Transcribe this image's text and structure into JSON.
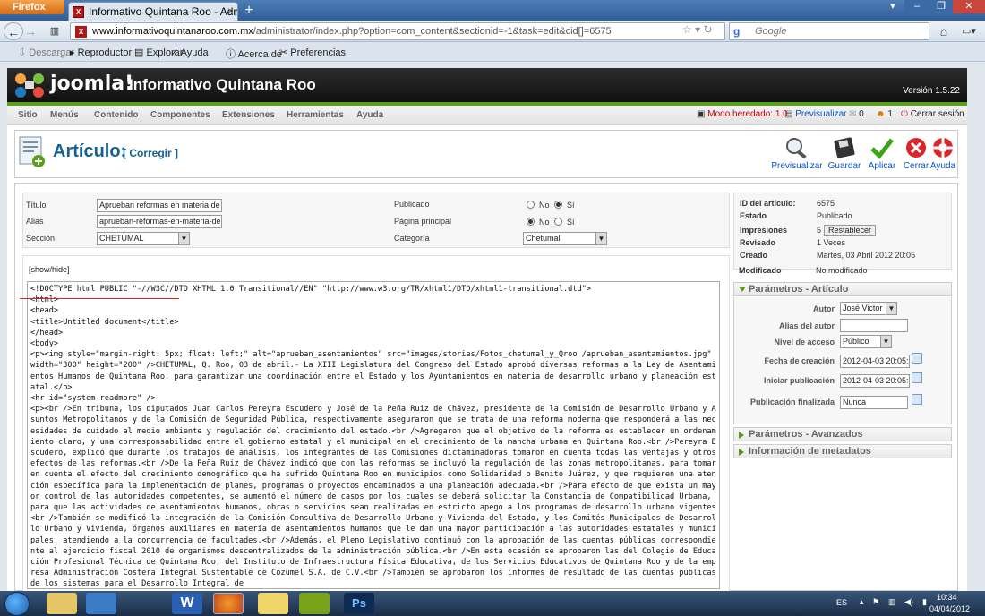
{
  "browser": {
    "menu_button": "Firefox",
    "tab_title": "Informativo Quintana Roo - Administrac...",
    "tab_favicon_text": "X",
    "url_domain": "www.informativoquintanaroo.com.mx",
    "url_path": "/administrator/index.php?option=com_content&sectionid=-1&task=edit&cid[]=6575",
    "search_engine": "Google",
    "search_placeholder": "Google",
    "bookmarks": [
      "Descargar",
      "Reproductor",
      "Explorar",
      "Ayuda",
      "Acerca de",
      "Preferencias"
    ]
  },
  "joomla": {
    "brand": "joomla!",
    "site_name": "Informativo Quintana Roo",
    "version": "Versión 1.5.22",
    "menu": [
      "Sitio",
      "Menús",
      "Contenido",
      "Componentes",
      "Extensiones",
      "Herramientas",
      "Ayuda"
    ],
    "status": {
      "legacy": "Modo heredado: 1.0",
      "preview": "Previsualizar",
      "messages": "0",
      "users": "1",
      "logout": "Cerrar sesión"
    }
  },
  "toolbar": {
    "title": "Artículo:",
    "subtitle": "[ Corregir ]",
    "buttons": [
      "Previsualizar",
      "Guardar",
      "Aplicar",
      "Cerrar",
      "Ayuda"
    ]
  },
  "details": {
    "titulo_label": "Título",
    "titulo_value": "Aprueban reformas en materia de ase",
    "alias_label": "Alias",
    "alias_value": "aprueban-reformas-en-materia-de-ase",
    "seccion_label": "Sección",
    "seccion_value": "CHETUMAL",
    "publicado_label": "Publicado",
    "principal_label": "Página principal",
    "categoria_label": "Categoría",
    "categoria_value": "Chetumal",
    "no": "No",
    "si": "Sí",
    "publicado_value": "Sí",
    "principal_value": "No"
  },
  "editor": {
    "showhide": "[show/hide]",
    "lines": [
      "<!DOCTYPE html PUBLIC \"-//W3C//DTD XHTML 1.0 Transitional//EN\" \"http://www.w3.org/TR/xhtml1/DTD/xhtml1-transitional.dtd\">",
      "<html>",
      "<head>",
      "<title>Untitled document</title>",
      "</head>",
      "<body>",
      "<p><img style=\"margin-right: 5px; float: left;\" alt=\"aprueban_asentamientos\" src=\"images/stories/Fotos_chetumal_y_Qroo /aprueban_asentamientos.jpg\" width=\"300\" height=\"200\" />CHETUMAL, Q. Roo, 03 de abril.- La XIII Legislatura del Congreso del Estado aprobó diversas reformas a la Ley de Asentamientos Humanos de Quintana Roo, para garantizar una coordinación entre el Estado y los Ayuntamientos en materia de desarrollo urbano y planeación estatal.</p>",
      "<hr id=\"system-readmore\" />",
      "<p><br />En tribuna, los diputados Juan Carlos Pereyra Escudero y José de la Peña Ruiz de Chávez, presidente de la Comisión de Desarrollo Urbano y Asuntos Metropolitanos y de la Comisión de Seguridad Pública, respectivamente aseguraron que se trata de una reforma moderna que responderá a las necesidades de cuidado al medio ambiente y regulación del crecimiento del estado.<br />Agregaron que el objetivo de la reforma es establecer un ordenamiento claro, y una corresponsabilidad entre el gobierno estatal y el municipal en el crecimiento de la mancha urbana en Quintana Roo.<br />Pereyra Escudero, explicó que durante los trabajos de análisis, los integrantes de las Comisiones dictaminadoras tomaron en cuenta todas las ventajas y otros efectos de las reformas.<br />De la Peña Ruiz de Chávez indicó que con las reformas se incluyó la regulación de las zonas metropolitanas, para tomar en cuenta el efecto del crecimiento demográfico que ha sufrido Quintana Roo en municipios como Solidaridad o Benito Juárez, y que requieren una atención específica para la implementación de planes, programas o proyectos encaminados a una planeación adecuada.<br />Para efecto de que exista un mayor control de las autoridades competentes, se aumentó el número de casos por los cuales se deberá solicitar la Constancia de Compatibilidad Urbana, para que las actividades de asentamientos humanos, obras o servicios sean realizadas en estricto apego a los programas de desarrollo urbano vigentes<br />También se modificó la integración de la Comisión Consultiva de Desarrollo Urbano y Vivienda del Estado, y los Comités Municipales de Desarrollo Urbano y Vivienda, órganos auxiliares en materia de asentamientos humanos que le dan una mayor participación a las autoridades estatales y municipales, atendiendo a la concurrencia de facultades.<br />Además, el Pleno Legislativo continuó con la aprobación de las cuentas públicas correspondiente al ejercicio fiscal 2010 de organismos descentralizados de la administración pública.<br />En esta ocasión se aprobaron las del Colegio de Educación Profesional Técnica de Quintana Roo, del Instituto de Infraestructura Física Educativa, de los Servicios Educativos de Quintana Roo y de la empresa Administración Costera Integral Sustentable de Cozumel S.A. de C.V.<br />También se aprobaron los informes de resultado de las cuentas públicas de los sistemas para el Desarrollo Integral de"
    ]
  },
  "info": {
    "id_label": "ID del artículo:",
    "id_value": "6575",
    "estado_label": "Estado",
    "estado_value": "Publicado",
    "impresiones_label": "Impresiones",
    "impresiones_value": "5",
    "reset_label": "Restablecer",
    "revisado_label": "Revisado",
    "revisado_value": "1 Veces",
    "creado_label": "Creado",
    "creado_value": "Martes, 03 Abril 2012 20:05",
    "modificado_label": "Modificado",
    "modificado_value": "No modificado"
  },
  "params": {
    "heading": "Parámetros - Artículo",
    "autor_label": "Autor",
    "autor_value": "José Victor",
    "alias_autor_label": "Alias del autor",
    "alias_autor_value": "",
    "acceso_label": "Nivel de acceso",
    "acceso_value": "Público",
    "creacion_label": "Fecha de creación",
    "creacion_value": "2012-04-03 20:05:50",
    "inicio_label": "Iniciar publicación",
    "inicio_value": "2012-04-03 20:05:50",
    "fin_label": "Publicación finalizada",
    "fin_value": "Nunca",
    "advanced_heading": "Parámetros - Avanzados",
    "metadata_heading": "Información de metadatos"
  },
  "taskbar": {
    "language": "ES",
    "time": "10:34",
    "date": "04/04/2012"
  },
  "colors": {
    "joomla_green": "#5aa01b",
    "title_blue": "#146295",
    "link_blue": "#0b55c4",
    "annotation_red": "#d22222"
  }
}
